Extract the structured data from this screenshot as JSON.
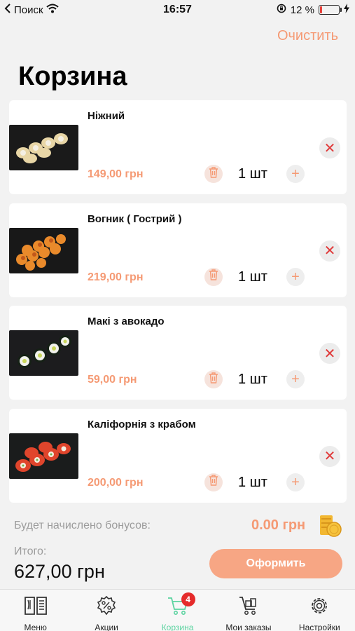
{
  "status_bar": {
    "back_app": "Поиск",
    "time": "16:57",
    "battery": "12 %",
    "battery_level": 0.12
  },
  "header": {
    "clear_label": "Очистить",
    "title": "Корзина"
  },
  "cart_items": [
    {
      "name": "Ніжний",
      "price": "149,00 грн",
      "quantity": "1 шт"
    },
    {
      "name": "Вогник ( Гострий )",
      "price": "219,00 грн",
      "quantity": "1 шт"
    },
    {
      "name": "Макі з авокадо",
      "price": "59,00 грн",
      "quantity": "1 шт"
    },
    {
      "name": "Каліфорнія з крабом",
      "price": "200,00 грн",
      "quantity": "1 шт"
    }
  ],
  "summary": {
    "bonus_label": "Будет начислено бонусов:",
    "bonus_value": "0.00 грн",
    "total_label": "Итого:",
    "total_value": "627,00 грн",
    "checkout_label": "Оформить"
  },
  "tab_bar": {
    "tabs": [
      {
        "label": "Меню",
        "icon": "menu-book-icon"
      },
      {
        "label": "Акции",
        "icon": "discount-icon"
      },
      {
        "label": "Корзина",
        "icon": "cart-icon",
        "badge": "4",
        "active": true
      },
      {
        "label": "Мои заказы",
        "icon": "orders-cart-icon"
      },
      {
        "label": "Настройки",
        "icon": "gear-icon"
      }
    ]
  },
  "colors": {
    "accent": "#f59a74",
    "button": "#f7a684",
    "active_tab": "#5bd3a0",
    "badge": "#e52b2b",
    "remove": "#e03a3a"
  }
}
